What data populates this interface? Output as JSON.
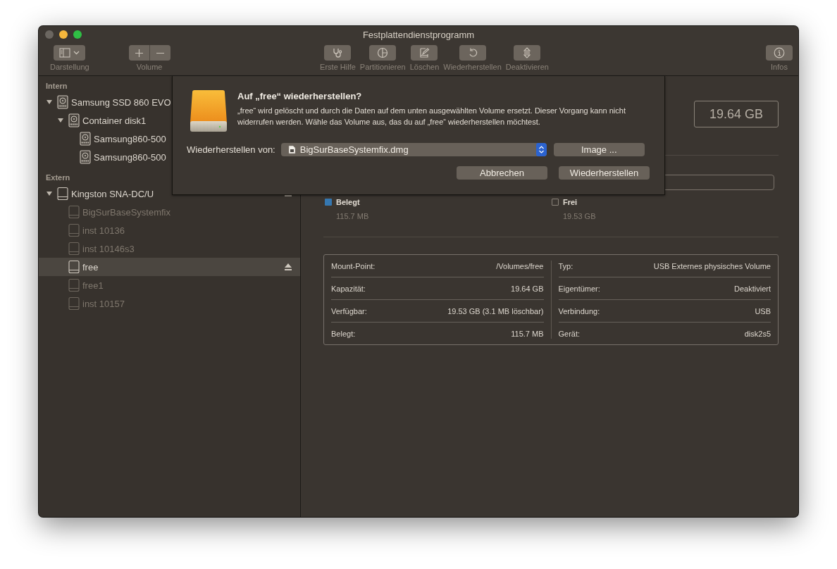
{
  "window": {
    "title": "Festplattendienstprogramm"
  },
  "toolbar": {
    "left": [
      {
        "label": "Darstellung",
        "kind": "view"
      },
      {
        "label": "Volume",
        "kind": "addremove"
      }
    ],
    "center": [
      {
        "label": "Erste Hilfe",
        "kind": "firstaid"
      },
      {
        "label": "Partitionieren",
        "kind": "partition"
      },
      {
        "label": "Löschen",
        "kind": "erase"
      },
      {
        "label": "Wiederherstellen",
        "kind": "restore"
      },
      {
        "label": "Deaktivieren",
        "kind": "unmount"
      }
    ],
    "right": [
      {
        "label": "Infos",
        "kind": "info"
      }
    ]
  },
  "sidebar": {
    "sections": [
      {
        "title": "Intern",
        "items": [
          {
            "label": "Samsung SSD 860 EVO",
            "kind": "internal",
            "mounted": true,
            "selected": false,
            "expanded": true,
            "children": [
              {
                "label": "Container disk1",
                "kind": "internal",
                "mounted": true,
                "selected": false,
                "expanded": true,
                "children": [
                  {
                    "label": "Samsung860-500",
                    "kind": "internal",
                    "mounted": true,
                    "selected": false
                  },
                  {
                    "label": "Samsung860-500",
                    "kind": "internal",
                    "mounted": true,
                    "selected": false
                  }
                ]
              }
            ]
          }
        ]
      },
      {
        "title": "Extern",
        "items": [
          {
            "label": "Kingston SNA-DC/U",
            "kind": "external",
            "mounted": true,
            "selected": false,
            "expanded": true,
            "busy_marker": true,
            "children": [
              {
                "label": "BigSurBaseSystemfix",
                "kind": "external",
                "mounted": false,
                "selected": false
              },
              {
                "label": "inst 10136",
                "kind": "external",
                "mounted": false,
                "selected": false
              },
              {
                "label": "inst 10146s3",
                "kind": "external",
                "mounted": false,
                "selected": false
              },
              {
                "label": "free",
                "kind": "external",
                "mounted": true,
                "selected": true,
                "ejectable": true
              },
              {
                "label": "free1",
                "kind": "external",
                "mounted": false,
                "selected": false
              },
              {
                "label": "inst 10157",
                "kind": "external",
                "mounted": false,
                "selected": false
              }
            ]
          }
        ]
      }
    ]
  },
  "main": {
    "capacity": "19.64 GB",
    "legend": [
      {
        "label": "Belegt",
        "value": "115.7 MB",
        "color": "#3577b0"
      },
      {
        "label": "Frei",
        "value": "19.53 GB",
        "color": "#3b3631"
      }
    ],
    "info_left": [
      {
        "label": "Mount-Point:",
        "value": "/Volumes/free"
      },
      {
        "label": "Kapazität:",
        "value": "19.64 GB"
      },
      {
        "label": "Verfügbar:",
        "value": "19.53 GB (3.1 MB löschbar)"
      },
      {
        "label": "Belegt:",
        "value": "115.7 MB"
      }
    ],
    "info_right": [
      {
        "label": "Typ:",
        "value": "USB Externes physisches Volume"
      },
      {
        "label": "Eigentümer:",
        "value": "Deaktiviert"
      },
      {
        "label": "Verbindung:",
        "value": "USB"
      },
      {
        "label": "Gerät:",
        "value": "disk2s5"
      }
    ]
  },
  "dialog": {
    "title": "Auf „free“ wiederherstellen?",
    "message": "„free“ wird gelöscht und durch die Daten auf dem unten ausgewählten Volume ersetzt. Dieser Vorgang kann nicht widerrufen werden. Wähle das Volume aus, das du auf „free“ wiederherstellen möchtest.",
    "source_label": "Wiederherstellen von:",
    "source_value": "BigSurBaseSystemfix.dmg",
    "image_button": "Image ...",
    "buttons": [
      "Abbrechen",
      "Wiederherstellen"
    ]
  }
}
